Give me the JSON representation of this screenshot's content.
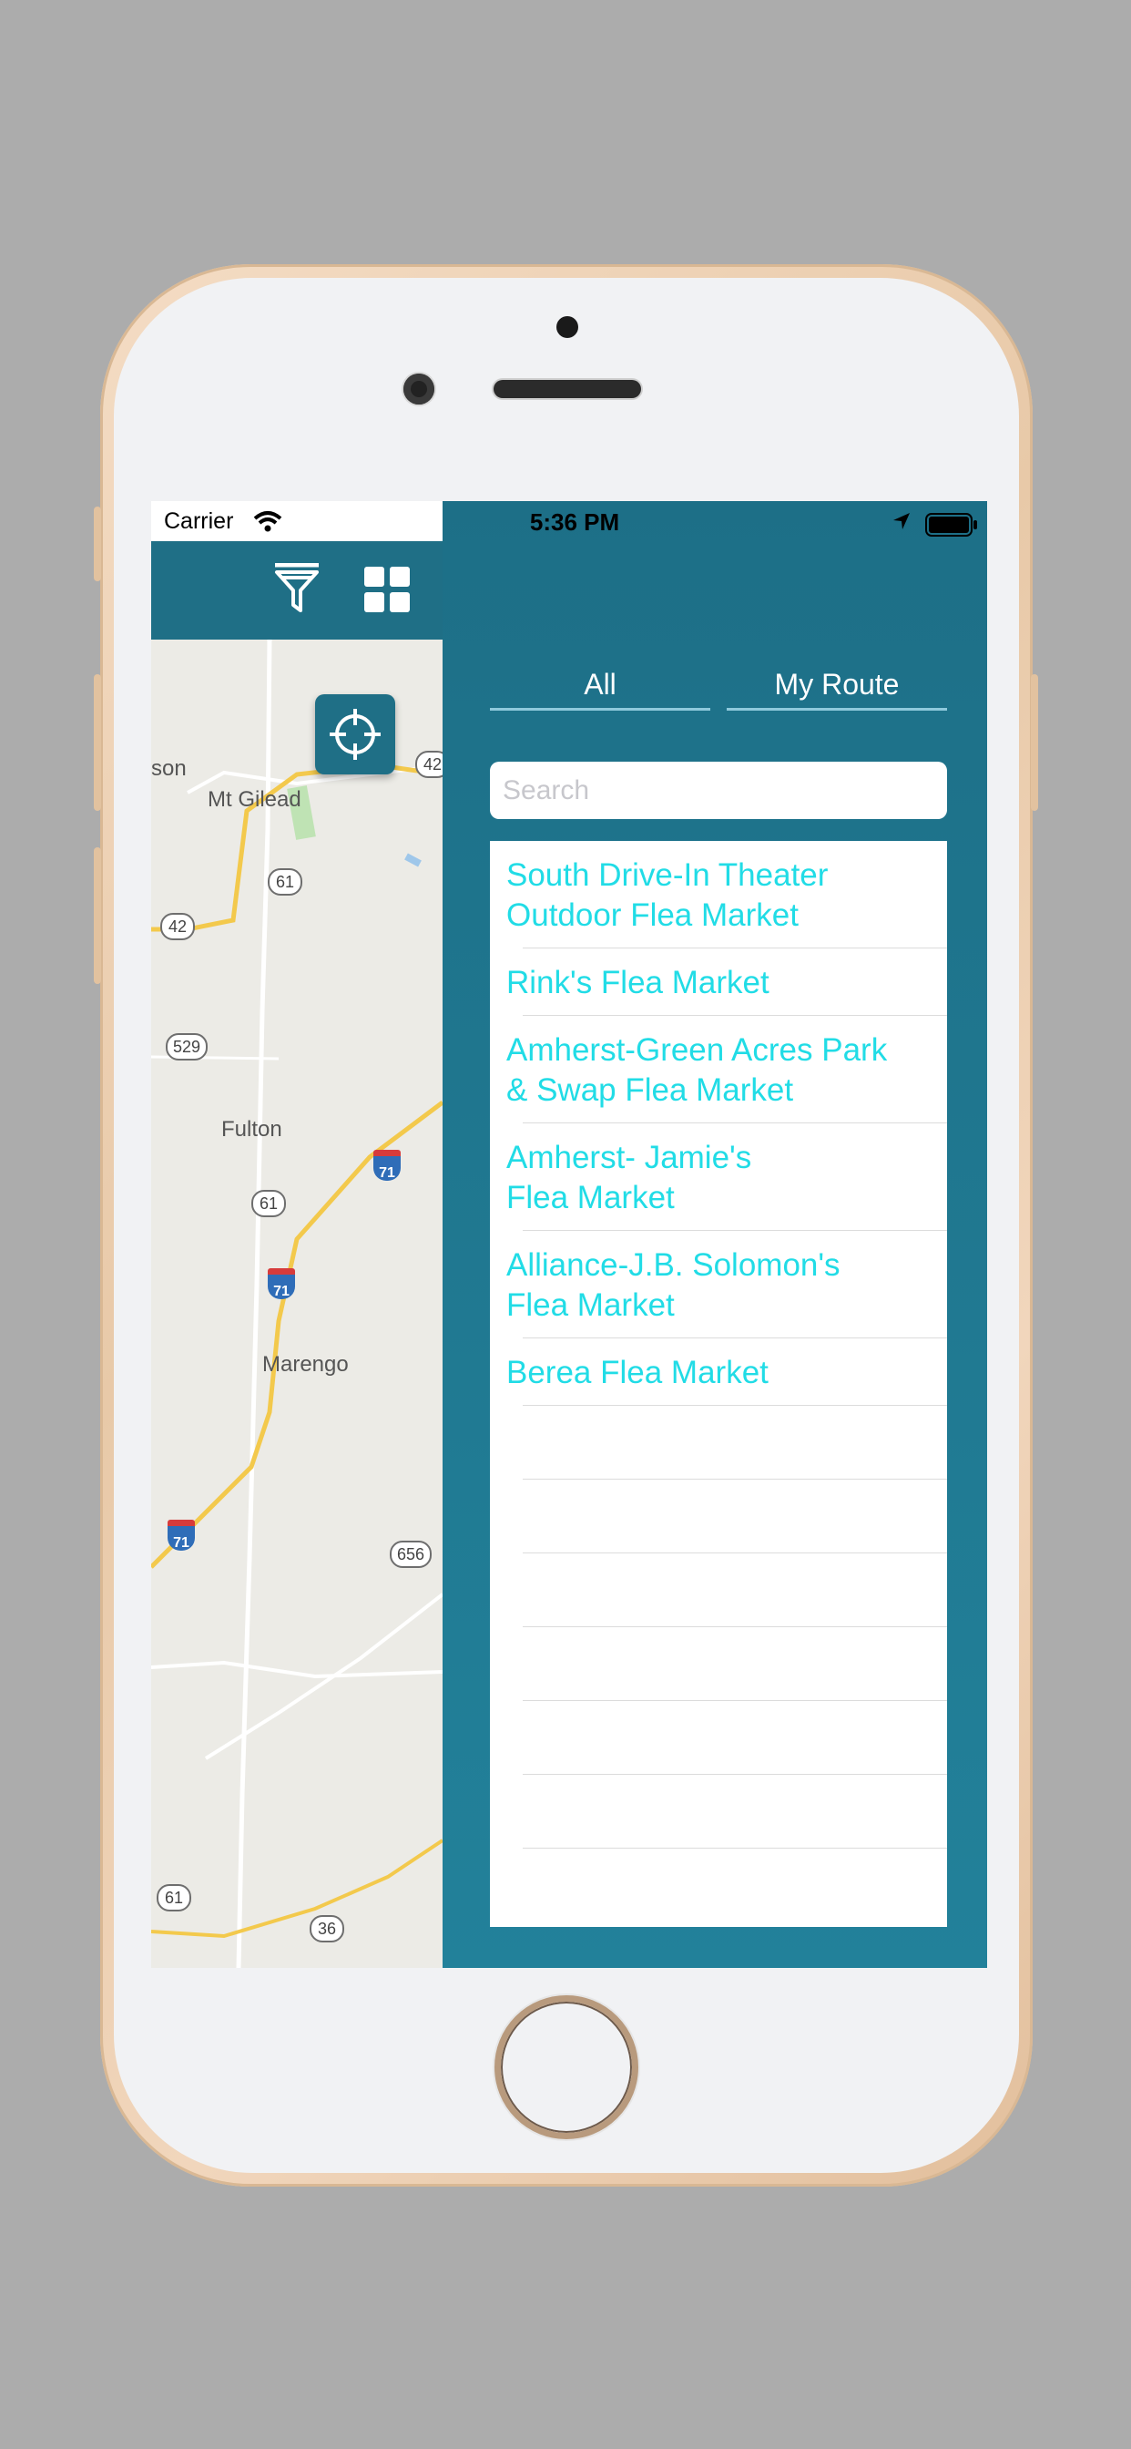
{
  "status_bar": {
    "carrier": "Carrier",
    "time": "5:36 PM"
  },
  "map": {
    "place_labels": [
      "son",
      "Mt Gilead",
      "Fulton",
      "Marengo"
    ],
    "route_shields": [
      "42",
      "61",
      "42",
      "529",
      "61",
      "656",
      "61",
      "36"
    ],
    "interstate_shields": [
      "71",
      "71",
      "71"
    ]
  },
  "toolbar": {
    "icons": [
      "filter-icon",
      "grid-icon"
    ],
    "locate_icon": "crosshair-icon"
  },
  "drawer": {
    "tabs": [
      {
        "label": "All"
      },
      {
        "label": "My Route"
      }
    ],
    "search": {
      "placeholder": "Search",
      "value": ""
    },
    "markets": [
      {
        "name": "South Drive-In Theater\nOutdoor Flea Market"
      },
      {
        "name": "Rink's Flea Market"
      },
      {
        "name": "Amherst-Green Acres Park\n& Swap Flea Market"
      },
      {
        "name": "Amherst- Jamie's\nFlea Market"
      },
      {
        "name": "Alliance-J.B. Solomon's\nFlea Market"
      },
      {
        "name": "Berea Flea Market"
      }
    ]
  },
  "colors": {
    "accent": "#1f6f86",
    "link": "#21dce6",
    "background": "#acacac"
  }
}
